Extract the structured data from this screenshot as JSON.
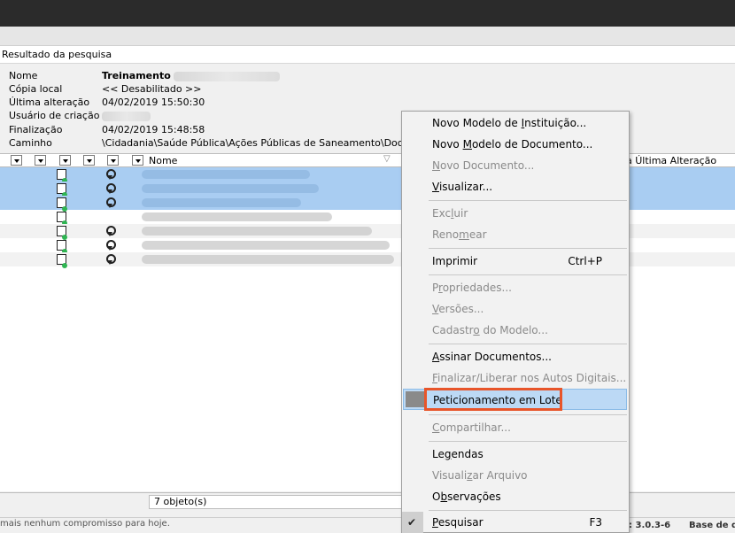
{
  "panel": {
    "title": "Resultado da pesquisa"
  },
  "info": {
    "rows": [
      {
        "label": "Nome",
        "value": "Treinamento"
      },
      {
        "label": "Cópia local",
        "value": "<< Desabilitado >>"
      },
      {
        "label": "Última alteração",
        "value": "04/02/2019 15:50:30"
      },
      {
        "label": "Usuário de criação",
        "value": ""
      },
      {
        "label": "Finalização",
        "value": "04/02/2019 15:48:58"
      },
      {
        "label": "Caminho",
        "value": "\\Cidadania\\Saúde Pública\\Ações Públicas de Saneamento\\Docum"
      }
    ]
  },
  "grid": {
    "columns": {
      "name": "Nome",
      "last_change": "a Última Alteração"
    }
  },
  "status": {
    "count": "7 objeto(s)"
  },
  "bottom": {
    "message": "mais nenhum compromisso para hoje.",
    "version": ": 3.0.3-6",
    "base": "Base de d"
  },
  "menu": {
    "items": [
      {
        "pre": "Novo Modelo de ",
        "u": "I",
        "post": "nstituição...",
        "enabled": true
      },
      {
        "pre": "Novo ",
        "u": "M",
        "post": "odelo de Documento...",
        "enabled": true
      },
      {
        "pre": "",
        "u": "N",
        "post": "ovo Documento...",
        "enabled": false
      },
      {
        "pre": "",
        "u": "V",
        "post": "isualizar...",
        "enabled": true
      },
      {
        "pre": "Exc",
        "u": "l",
        "post": "uir",
        "enabled": false
      },
      {
        "pre": "Reno",
        "u": "m",
        "post": "ear",
        "enabled": false
      },
      {
        "pre": "Imprimir",
        "u": "",
        "post": "",
        "enabled": true,
        "shortcut": "Ctrl+P"
      },
      {
        "pre": "P",
        "u": "r",
        "post": "opriedades...",
        "enabled": false
      },
      {
        "pre": "",
        "u": "V",
        "post": "ersões...",
        "enabled": false
      },
      {
        "pre": "Cadastr",
        "u": "o",
        "post": " do Modelo...",
        "enabled": false
      },
      {
        "pre": "",
        "u": "A",
        "post": "ssinar Documentos...",
        "enabled": true
      },
      {
        "pre": "",
        "u": "F",
        "post": "inalizar/Liberar nos Autos Digitais...",
        "enabled": false
      },
      {
        "pre": "Peticionamento em Lote",
        "u": "",
        "post": "",
        "enabled": true,
        "highlighted": true
      },
      {
        "pre": "",
        "u": "C",
        "post": "ompartilhar...",
        "enabled": false
      },
      {
        "pre": "Le",
        "u": "g",
        "post": "endas",
        "enabled": true
      },
      {
        "pre": "Visuali",
        "u": "z",
        "post": "ar Arquivo",
        "enabled": false
      },
      {
        "pre": "O",
        "u": "b",
        "post": "servações",
        "enabled": true
      },
      {
        "pre": "",
        "u": "P",
        "post": "esquisar",
        "enabled": true,
        "shortcut": "F3",
        "checked": true
      }
    ]
  },
  "colors": {
    "selection": "#a9cdf2",
    "menu_highlight": "#bcd9f5",
    "callout": "#e8552a"
  }
}
